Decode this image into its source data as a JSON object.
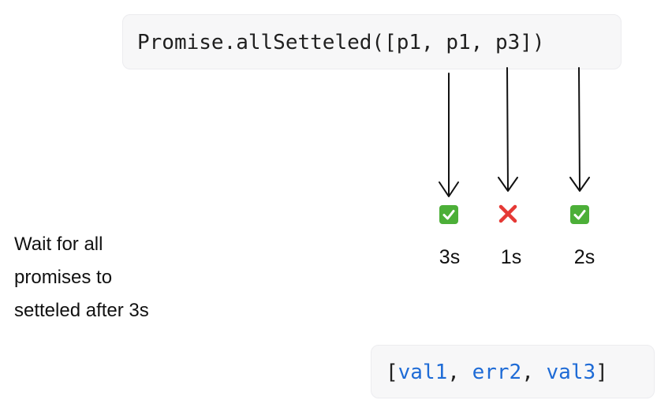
{
  "top_code": {
    "text": "Promise.allSetteled([p1, p1, p3])"
  },
  "promises": [
    {
      "status": "fulfilled",
      "icon": "check-mark-button-icon",
      "time": "3s"
    },
    {
      "status": "rejected",
      "icon": "cross-mark-icon",
      "time": "1s"
    },
    {
      "status": "fulfilled",
      "icon": "check-mark-button-icon",
      "time": "2s"
    }
  ],
  "note": {
    "lines": [
      "Wait for all",
      "promises to",
      "setteled after 3s"
    ]
  },
  "result": {
    "open_bracket": "[",
    "items": [
      "val1",
      "err2",
      "val3"
    ],
    "separator": ", ",
    "close_bracket": "]"
  },
  "colors": {
    "code_background": "#f7f7f8",
    "result_value": "#1e6bd6",
    "check": "#4caf38",
    "cross": "#e53935"
  }
}
